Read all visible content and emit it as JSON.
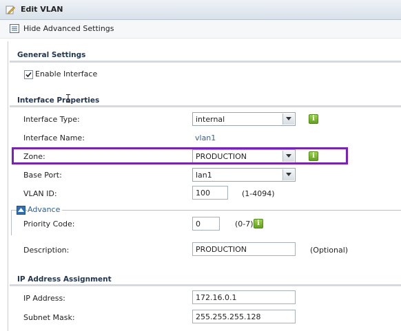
{
  "window": {
    "title": "Edit VLAN",
    "toolbar_link": "Hide Advanced Settings"
  },
  "sections": {
    "general": "General Settings",
    "interface": "Interface Properties",
    "ip": "IP Address Assignment"
  },
  "general": {
    "enable_interface": {
      "label": "Enable Interface",
      "checked": true
    }
  },
  "interface": {
    "type": {
      "label": "Interface Type:",
      "value": "internal"
    },
    "name": {
      "label": "Interface Name:",
      "value": "vlan1"
    },
    "zone": {
      "label": "Zone:",
      "value": "PRODUCTION"
    },
    "base_port": {
      "label": "Base Port:",
      "value": "lan1"
    },
    "vlan_id": {
      "label": "VLAN ID:",
      "value": "100",
      "hint": "(1-4094)"
    },
    "advance": {
      "label": "Advance"
    },
    "priority": {
      "label": "Priority Code:",
      "value": "0",
      "hint": "(0-7)"
    },
    "description": {
      "label": "Description:",
      "value": "PRODUCTION",
      "hint": "(Optional)"
    }
  },
  "ip": {
    "address": {
      "label": "IP Address:",
      "value": "172.16.0.1"
    },
    "mask": {
      "label": "Subnet Mask:",
      "value": "255.255.255.128"
    }
  },
  "icons": {
    "info": "i"
  },
  "colors": {
    "highlight": "#7a1fc2",
    "info_green": "#6fb52a",
    "section_text": "#1f3552"
  }
}
